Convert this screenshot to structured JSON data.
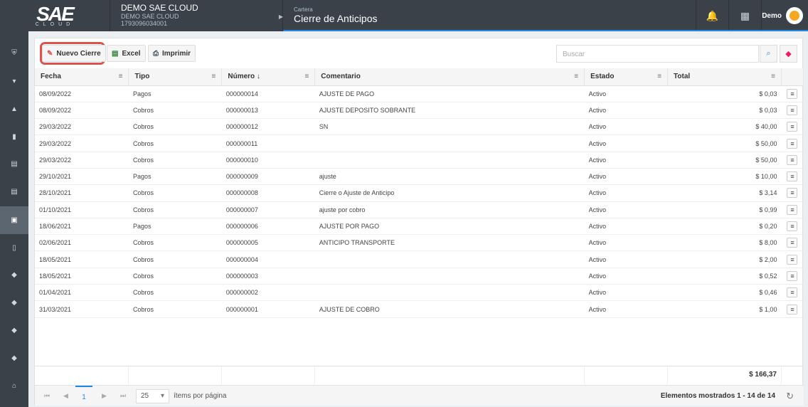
{
  "header": {
    "logo_text": "SAE",
    "logo_sub": "CLOUD",
    "company_name": "DEMO SAE CLOUD",
    "company_sub": "DEMO SAE CLOUD",
    "company_ruc": "1793096034001",
    "module": "Cartera",
    "page_title": "Cierre de Anticipos",
    "user": "Demo"
  },
  "toolbar": {
    "new_label": "Nuevo Cierre",
    "excel_label": "Excel",
    "print_label": "Imprimir",
    "search_placeholder": "Buscar"
  },
  "columns": [
    "Fecha",
    "Tipo",
    "Número ↓",
    "Comentario",
    "Estado",
    "Total"
  ],
  "rows": [
    {
      "fecha": "08/09/2022",
      "tipo": "Pagos",
      "numero": "000000014",
      "comentario": "AJUSTE DE PAGO",
      "estado": "Activo",
      "total": "$ 0,03"
    },
    {
      "fecha": "08/09/2022",
      "tipo": "Cobros",
      "numero": "000000013",
      "comentario": "AJUSTE DEPOSITO SOBRANTE",
      "estado": "Activo",
      "total": "$ 0,03"
    },
    {
      "fecha": "29/03/2022",
      "tipo": "Cobros",
      "numero": "000000012",
      "comentario": "SN",
      "estado": "Activo",
      "total": "$ 40,00"
    },
    {
      "fecha": "29/03/2022",
      "tipo": "Cobros",
      "numero": "000000011",
      "comentario": "",
      "estado": "Activo",
      "total": "$ 50,00"
    },
    {
      "fecha": "29/03/2022",
      "tipo": "Cobros",
      "numero": "000000010",
      "comentario": "",
      "estado": "Activo",
      "total": "$ 50,00"
    },
    {
      "fecha": "29/10/2021",
      "tipo": "Pagos",
      "numero": "000000009",
      "comentario": "ajuste",
      "estado": "Activo",
      "total": "$ 10,00"
    },
    {
      "fecha": "28/10/2021",
      "tipo": "Cobros",
      "numero": "000000008",
      "comentario": "Cierre o Ajuste de Anticipo",
      "estado": "Activo",
      "total": "$ 3,14"
    },
    {
      "fecha": "01/10/2021",
      "tipo": "Cobros",
      "numero": "000000007",
      "comentario": "ajuste por cobro",
      "estado": "Activo",
      "total": "$ 0,99"
    },
    {
      "fecha": "18/06/2021",
      "tipo": "Pagos",
      "numero": "000000006",
      "comentario": "AJUSTE POR PAGO",
      "estado": "Activo",
      "total": "$ 0,20"
    },
    {
      "fecha": "02/06/2021",
      "tipo": "Cobros",
      "numero": "000000005",
      "comentario": "ANTICIPO TRANSPORTE",
      "estado": "Activo",
      "total": "$ 8,00"
    },
    {
      "fecha": "18/05/2021",
      "tipo": "Cobros",
      "numero": "000000004",
      "comentario": "",
      "estado": "Activo",
      "total": "$ 2,00"
    },
    {
      "fecha": "18/05/2021",
      "tipo": "Cobros",
      "numero": "000000003",
      "comentario": "",
      "estado": "Activo",
      "total": "$ 0,52"
    },
    {
      "fecha": "01/04/2021",
      "tipo": "Cobros",
      "numero": "000000002",
      "comentario": "",
      "estado": "Activo",
      "total": "$ 0,46"
    },
    {
      "fecha": "31/03/2021",
      "tipo": "Cobros",
      "numero": "000000001",
      "comentario": "AJUSTE DE COBRO",
      "estado": "Activo",
      "total": "$ 1,00"
    }
  ],
  "footer": {
    "grand_total": "$ 166,37",
    "current_page": "1",
    "page_size": "25",
    "items_per_page": "ítems por página",
    "info": "Elementos mostrados 1 - 14 de 14"
  }
}
